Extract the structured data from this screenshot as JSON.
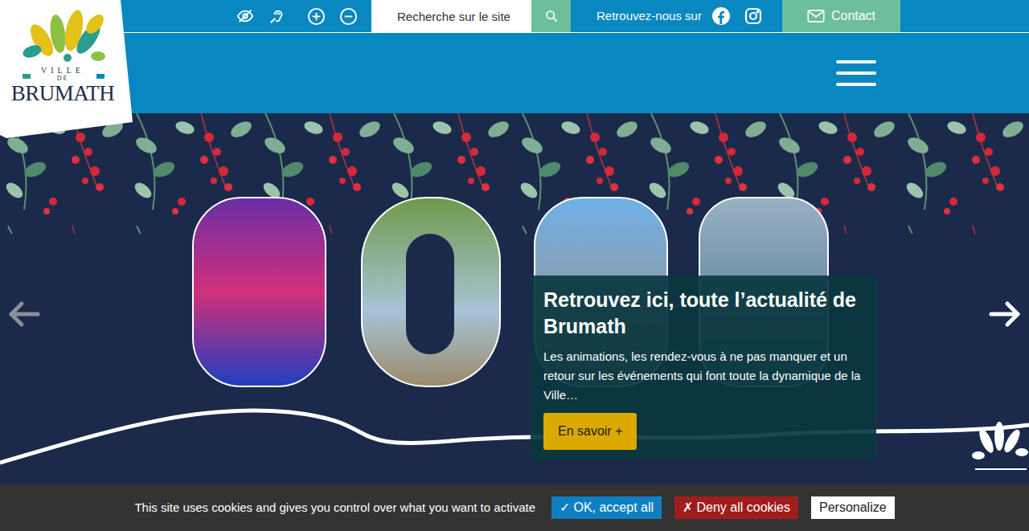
{
  "logo": {
    "top": "VILLE",
    "middle": "DE",
    "name": "BRUMATH"
  },
  "search": {
    "placeholder": "Recherche sur le site"
  },
  "social": {
    "label": "Retrouvez-nous sur"
  },
  "contact": {
    "label": "Contact"
  },
  "slider": {
    "title": "Retrouvez ici, toute l’actualité de Brumath",
    "text": "Les animations, les rendez-vous à ne pas manquer et un retour sur les événements qui font toute la dynamique de la Ville…",
    "button": "En savoir +"
  },
  "cookies": {
    "message": "This site uses cookies and gives you control over what you want to activate",
    "buttons": [
      {
        "label": "✓ OK, accept all",
        "kind": "accept"
      },
      {
        "label": "✗ Deny all cookies",
        "kind": "deny"
      },
      {
        "label": "Personalize",
        "kind": "custom"
      }
    ]
  }
}
